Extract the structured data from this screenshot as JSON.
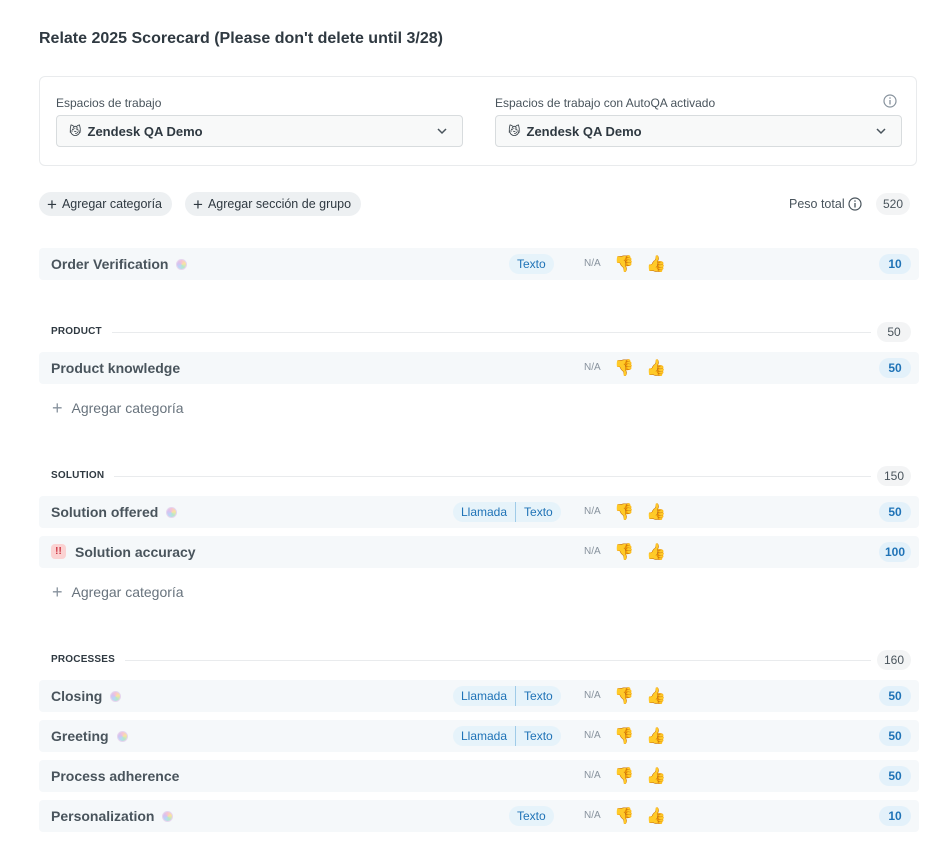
{
  "page": {
    "title": "Relate 2025 Scorecard (Please don't delete until 3/28)"
  },
  "workspaces": {
    "label": "Espacios de trabajo",
    "value": "Zendesk QA Demo",
    "autoqa_label": "Espacios de trabajo con AutoQA activado",
    "autoqa_value": "Zendesk QA Demo"
  },
  "toolbar": {
    "add_category": "Agregar categoría",
    "add_group_section": "Agregar sección de grupo",
    "total_weight_label": "Peso total",
    "total_weight_value": "520"
  },
  "common": {
    "na": "N/A",
    "thumbs_down": "👎",
    "thumbs_up": "👍",
    "add_category": "Agregar categoría"
  },
  "ungrouped": [
    {
      "name": "Order Verification",
      "tags": [
        "Texto"
      ],
      "score": "10"
    }
  ],
  "sections": [
    {
      "label": "PRODUCT",
      "total": "50",
      "rows": [
        {
          "name": "Product knowledge",
          "tags": [],
          "score": "50"
        }
      ]
    },
    {
      "label": "SOLUTION",
      "total": "150",
      "rows": [
        {
          "name": "Solution offered",
          "tags": [
            "Llamada",
            "Texto"
          ],
          "score": "50"
        },
        {
          "name": "Solution accuracy",
          "tags": [],
          "score": "100",
          "alert": "!!"
        }
      ]
    },
    {
      "label": "PROCESSES",
      "total": "160",
      "rows": [
        {
          "name": "Closing",
          "tags": [
            "Llamada",
            "Texto"
          ],
          "score": "50"
        },
        {
          "name": "Greeting",
          "tags": [
            "Llamada",
            "Texto"
          ],
          "score": "50"
        },
        {
          "name": "Process adherence",
          "tags": [],
          "score": "50"
        },
        {
          "name": "Personalization",
          "tags": [
            "Texto"
          ],
          "score": "10"
        }
      ]
    }
  ],
  "icons": {
    "workspace_emoji": "😼",
    "chevron": "chevron-down-icon",
    "info": "info-icon",
    "plus": "+"
  }
}
